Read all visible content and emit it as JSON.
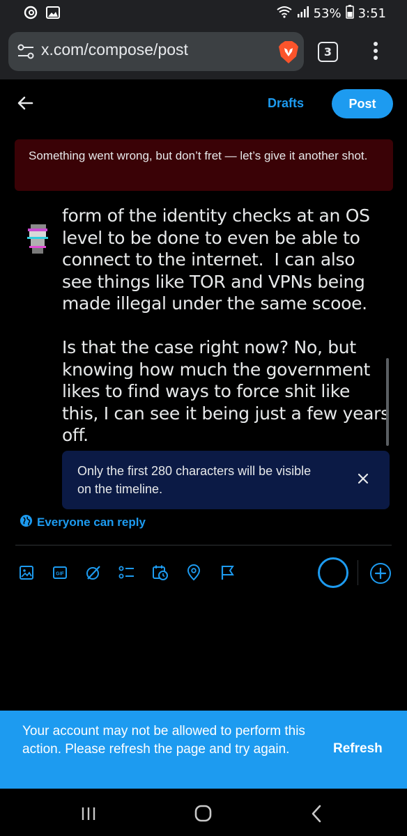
{
  "status_bar": {
    "battery": "53%",
    "time": "3:51",
    "icons": [
      "threads-icon",
      "image-icon",
      "wifi-icon",
      "signal-icon",
      "battery-icon"
    ]
  },
  "browser": {
    "url": "x.com/compose/post",
    "tab_count": "3",
    "icons": [
      "tune-icon",
      "brave-lion-icon",
      "menu-dots-icon"
    ]
  },
  "compose_header": {
    "drafts_label": "Drafts",
    "post_label": "Post"
  },
  "error_banner": {
    "text": "Something went wrong, but don’t fret — let’s give it another shot."
  },
  "tweet": {
    "text": "form of the identity checks at an OS level to be done to even be able to connect to the internet.  I can also see things like TOR and VPNs being made illegal under the same scooe.\n\nIs that the case right now? No, but knowing how much the government likes to find ways to force shit like this, I can see it being just a few years off."
  },
  "info_toast": {
    "text": "Only the first 280 characters will be visible on the timeline."
  },
  "reply_setting": {
    "label": "Everyone can reply"
  },
  "toolbar": {
    "items": [
      "media-icon",
      "gif-icon",
      "grok-icon",
      "poll-icon",
      "schedule-icon",
      "location-icon",
      "flag-icon"
    ]
  },
  "account_banner": {
    "text": "Your account may not be allowed to perform this action. Please refresh the page and try again.",
    "refresh_label": "Refresh"
  },
  "colors": {
    "accent": "#1d9bf0",
    "error_bg": "#3a0206",
    "info_bg": "#0b1a45",
    "background": "#000000"
  }
}
